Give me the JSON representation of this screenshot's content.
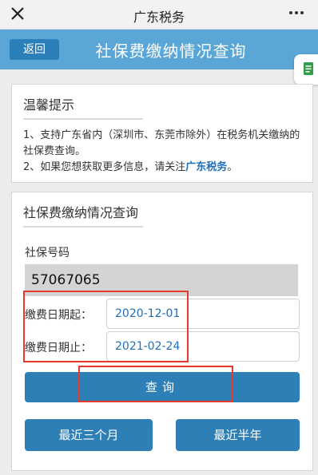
{
  "wechat": {
    "title": "广东税务",
    "close_icon": "close-icon",
    "more_icon": "more-icon"
  },
  "banner": {
    "back_label": "返回",
    "title": "社保费缴纳情况查询",
    "side_icon": "document-icon"
  },
  "tips": {
    "heading": "温馨提示",
    "line1": "1、支持广东省内（深圳市、东莞市除外）在税务机关缴纳的社保费查询。",
    "line2_prefix": "2、如果您想获取更多信息，请关注",
    "line2_link": "广东税务",
    "line2_suffix": "。"
  },
  "query": {
    "heading": "社保费缴纳情况查询",
    "ss_label": "社保号码",
    "ss_value": "57067065",
    "start_label": "缴费日期起：",
    "start_value": "2020-12-01",
    "end_label": "缴费日期止：",
    "end_value": "2021-02-24",
    "query_button": "查询",
    "recent_3m_button": "最近三个月",
    "recent_6m_button": "最近半年"
  },
  "colors": {
    "banner": "#5aa6d6",
    "button": "#2d7fb5",
    "highlight": "#e23a2e",
    "link": "#1e6fb8"
  }
}
